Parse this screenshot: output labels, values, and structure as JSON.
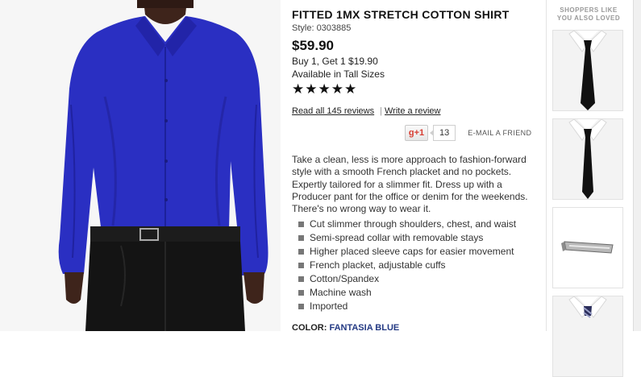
{
  "product": {
    "title": "FITTED 1MX STRETCH COTTON SHIRT",
    "style": "Style: 0303885",
    "price": "$59.90",
    "promo": "Buy 1, Get 1 $19.90",
    "tall_sizes": "Available in Tall Sizes",
    "rating": 5,
    "reviews_link": "Read all 145 reviews",
    "write_review": "Write a review",
    "separator": "|",
    "gplus_label": "g+1",
    "gplus_count": "13",
    "email_friend": "E-MAIL A FRIEND",
    "description": "Take a clean, less is more approach to fashion-forward style with a smooth French placket and no pockets. Expertly tailored for a slimmer fit. Dress up with a Producer pant for the office or denim for the weekends. There's no wrong way to wear it.",
    "features": [
      "Cut slimmer through shoulders, chest, and waist",
      "Semi-spread collar with removable stays",
      "Higher placed sleeve caps for easier movement",
      "French placket, adjustable cuffs",
      "Cotton/Spandex",
      "Machine wash",
      "Imported"
    ],
    "color_label": "COLOR: ",
    "color_value": "FANTASIA BLUE"
  },
  "sidebar": {
    "title_line1": "SHOPPERS LIKE",
    "title_line2": "YOU ALSO LOVED",
    "items": [
      {
        "icon": "black-tie-icon"
      },
      {
        "icon": "black-tie-icon"
      },
      {
        "icon": "tie-bar-icon"
      },
      {
        "icon": "striped-tie-icon"
      }
    ]
  },
  "colors": {
    "shirt": "#2a2fc2",
    "pants": "#141414",
    "skin": "#4a2c22",
    "text_accent": "#243a84"
  }
}
